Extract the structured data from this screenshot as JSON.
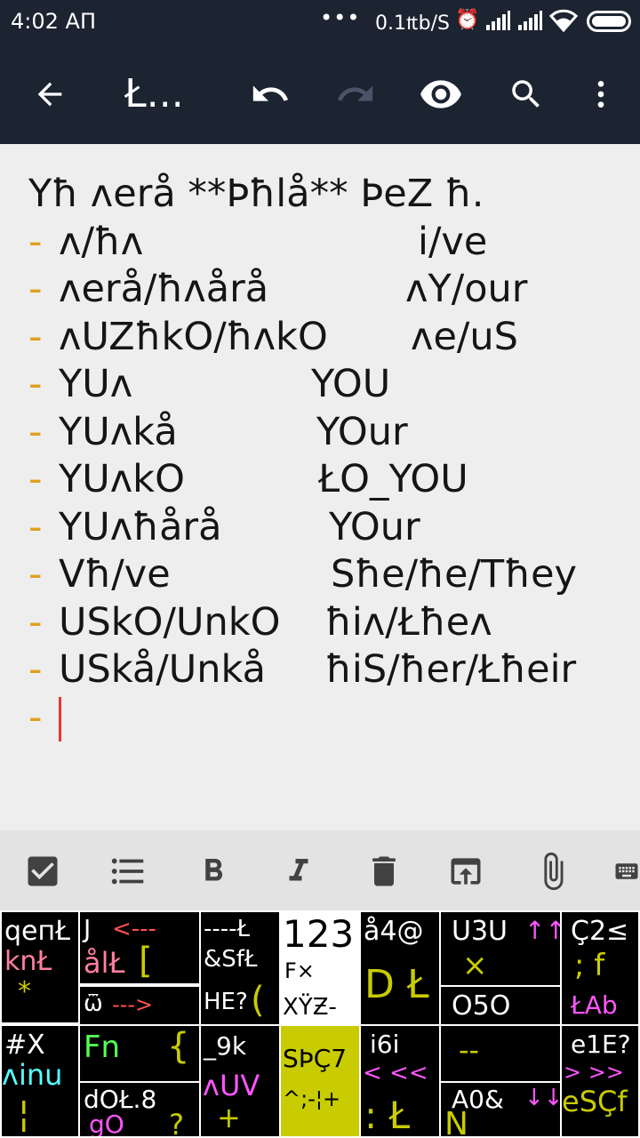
{
  "status": {
    "time": "4:02 AΠ",
    "dots": "•••",
    "speed": "0.1₶b/S",
    "alarm": "⏰"
  },
  "toolbar": {
    "title": "Ł..."
  },
  "editor": {
    "heading": "Yħ ʌerå **Þħlå** ÞeZ ħ.",
    "rows": [
      {
        "left": "ʌ/ħʌ",
        "right": "i/ve"
      },
      {
        "left": "ʌerå/ħʌårå",
        "right": "ʌY/our"
      },
      {
        "left": "ʌUZħkO/ħʌkO",
        "right": "ʌe/uS"
      },
      {
        "left": "YUʌ",
        "right": "YOU"
      },
      {
        "left": "YUʌkå",
        "right": "YOur"
      },
      {
        "left": "YUʌkO",
        "right": "ŁO_YOU"
      },
      {
        "left": "YUʌħårå",
        "right": "YOur"
      },
      {
        "left": "Vħ/ve",
        "right": "Sħe/ħe/Tħey"
      },
      {
        "left": "USkO/UnkO",
        "right": "ħiʌ/Łħeʌ"
      },
      {
        "left": "USkå/Unkå",
        "right": "ħiS/ħer/Łħeir"
      }
    ],
    "dash": "-"
  },
  "keyboard": {
    "k1a": "ԛeпŁ",
    "k1b": "knŁ",
    "k1c": "*",
    "k2a": "J",
    "k2b": "<---",
    "k2c": "ålŁ",
    "k2d": "[",
    "k2e": "ѿ",
    "k2f": "--->",
    "k3a": "----Ł",
    "k3b": "&SfŁ",
    "k3c": "HE?",
    "k3d": "(",
    "k4a": "123",
    "k4b": "F×",
    "k4c": "XŸƵ-",
    "k5a": "å4@",
    "k5b": "D Ł",
    "k6a": "U3U",
    "k6b": "↑↑",
    "k6c": "×",
    "k6d": "O5O",
    "k7a": "Ç2≤",
    "k7b": "; f",
    "k7c": "ŁAb",
    "k8a": "#X",
    "k8b": "ʌinu",
    "k8c": "¦",
    "k9a": "Fn",
    "k9b": "{",
    "k9c": "dOŁ.8",
    "k9d": "gO",
    "k9e": "?",
    "k10a": "_9k",
    "k10b": "ʌUV",
    "k10c": "+",
    "k11a": "SÞÇ7",
    "k11b": "^;-¦+",
    "k12a": "i6i",
    "k12b": "< <<",
    "k12c": ": Ł",
    "k13a": "--",
    "k13b": "A0&",
    "k13c": "↓↓",
    "k13d": "N",
    "k14a": "e1E?",
    "k14b": "> >>",
    "k14c": "eSÇf"
  },
  "colors": {
    "bar": "#1c2331",
    "editor_bg": "#eeeeee",
    "dash": "#e0a020",
    "cursor": "#e53935",
    "kb_yellow": "#c8cc00",
    "kb_red": "#ff5050",
    "kb_pink": "#ff7fa0",
    "kb_magenta": "#ff55ff",
    "kb_cyan": "#55ffff",
    "kb_green": "#55ff55"
  }
}
